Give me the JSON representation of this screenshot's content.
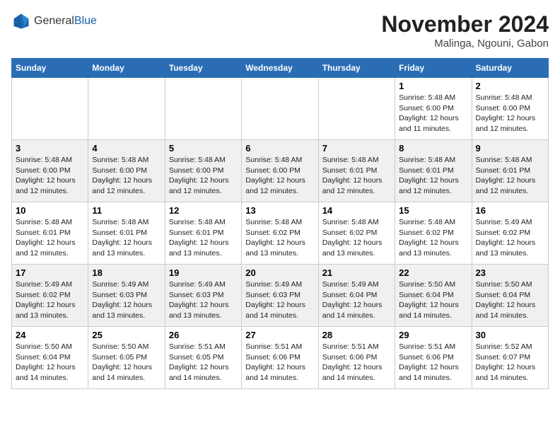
{
  "header": {
    "logo_general": "General",
    "logo_blue": "Blue",
    "month_title": "November 2024",
    "location": "Malinga, Ngouni, Gabon"
  },
  "weekdays": [
    "Sunday",
    "Monday",
    "Tuesday",
    "Wednesday",
    "Thursday",
    "Friday",
    "Saturday"
  ],
  "weeks": [
    [
      {
        "day": "",
        "info": ""
      },
      {
        "day": "",
        "info": ""
      },
      {
        "day": "",
        "info": ""
      },
      {
        "day": "",
        "info": ""
      },
      {
        "day": "",
        "info": ""
      },
      {
        "day": "1",
        "info": "Sunrise: 5:48 AM\nSunset: 6:00 PM\nDaylight: 12 hours\nand 11 minutes."
      },
      {
        "day": "2",
        "info": "Sunrise: 5:48 AM\nSunset: 6:00 PM\nDaylight: 12 hours\nand 12 minutes."
      }
    ],
    [
      {
        "day": "3",
        "info": "Sunrise: 5:48 AM\nSunset: 6:00 PM\nDaylight: 12 hours\nand 12 minutes."
      },
      {
        "day": "4",
        "info": "Sunrise: 5:48 AM\nSunset: 6:00 PM\nDaylight: 12 hours\nand 12 minutes."
      },
      {
        "day": "5",
        "info": "Sunrise: 5:48 AM\nSunset: 6:00 PM\nDaylight: 12 hours\nand 12 minutes."
      },
      {
        "day": "6",
        "info": "Sunrise: 5:48 AM\nSunset: 6:00 PM\nDaylight: 12 hours\nand 12 minutes."
      },
      {
        "day": "7",
        "info": "Sunrise: 5:48 AM\nSunset: 6:01 PM\nDaylight: 12 hours\nand 12 minutes."
      },
      {
        "day": "8",
        "info": "Sunrise: 5:48 AM\nSunset: 6:01 PM\nDaylight: 12 hours\nand 12 minutes."
      },
      {
        "day": "9",
        "info": "Sunrise: 5:48 AM\nSunset: 6:01 PM\nDaylight: 12 hours\nand 12 minutes."
      }
    ],
    [
      {
        "day": "10",
        "info": "Sunrise: 5:48 AM\nSunset: 6:01 PM\nDaylight: 12 hours\nand 12 minutes."
      },
      {
        "day": "11",
        "info": "Sunrise: 5:48 AM\nSunset: 6:01 PM\nDaylight: 12 hours\nand 13 minutes."
      },
      {
        "day": "12",
        "info": "Sunrise: 5:48 AM\nSunset: 6:01 PM\nDaylight: 12 hours\nand 13 minutes."
      },
      {
        "day": "13",
        "info": "Sunrise: 5:48 AM\nSunset: 6:02 PM\nDaylight: 12 hours\nand 13 minutes."
      },
      {
        "day": "14",
        "info": "Sunrise: 5:48 AM\nSunset: 6:02 PM\nDaylight: 12 hours\nand 13 minutes."
      },
      {
        "day": "15",
        "info": "Sunrise: 5:48 AM\nSunset: 6:02 PM\nDaylight: 12 hours\nand 13 minutes."
      },
      {
        "day": "16",
        "info": "Sunrise: 5:49 AM\nSunset: 6:02 PM\nDaylight: 12 hours\nand 13 minutes."
      }
    ],
    [
      {
        "day": "17",
        "info": "Sunrise: 5:49 AM\nSunset: 6:02 PM\nDaylight: 12 hours\nand 13 minutes."
      },
      {
        "day": "18",
        "info": "Sunrise: 5:49 AM\nSunset: 6:03 PM\nDaylight: 12 hours\nand 13 minutes."
      },
      {
        "day": "19",
        "info": "Sunrise: 5:49 AM\nSunset: 6:03 PM\nDaylight: 12 hours\nand 13 minutes."
      },
      {
        "day": "20",
        "info": "Sunrise: 5:49 AM\nSunset: 6:03 PM\nDaylight: 12 hours\nand 14 minutes."
      },
      {
        "day": "21",
        "info": "Sunrise: 5:49 AM\nSunset: 6:04 PM\nDaylight: 12 hours\nand 14 minutes."
      },
      {
        "day": "22",
        "info": "Sunrise: 5:50 AM\nSunset: 6:04 PM\nDaylight: 12 hours\nand 14 minutes."
      },
      {
        "day": "23",
        "info": "Sunrise: 5:50 AM\nSunset: 6:04 PM\nDaylight: 12 hours\nand 14 minutes."
      }
    ],
    [
      {
        "day": "24",
        "info": "Sunrise: 5:50 AM\nSunset: 6:04 PM\nDaylight: 12 hours\nand 14 minutes."
      },
      {
        "day": "25",
        "info": "Sunrise: 5:50 AM\nSunset: 6:05 PM\nDaylight: 12 hours\nand 14 minutes."
      },
      {
        "day": "26",
        "info": "Sunrise: 5:51 AM\nSunset: 6:05 PM\nDaylight: 12 hours\nand 14 minutes."
      },
      {
        "day": "27",
        "info": "Sunrise: 5:51 AM\nSunset: 6:06 PM\nDaylight: 12 hours\nand 14 minutes."
      },
      {
        "day": "28",
        "info": "Sunrise: 5:51 AM\nSunset: 6:06 PM\nDaylight: 12 hours\nand 14 minutes."
      },
      {
        "day": "29",
        "info": "Sunrise: 5:51 AM\nSunset: 6:06 PM\nDaylight: 12 hours\nand 14 minutes."
      },
      {
        "day": "30",
        "info": "Sunrise: 5:52 AM\nSunset: 6:07 PM\nDaylight: 12 hours\nand 14 minutes."
      }
    ]
  ]
}
